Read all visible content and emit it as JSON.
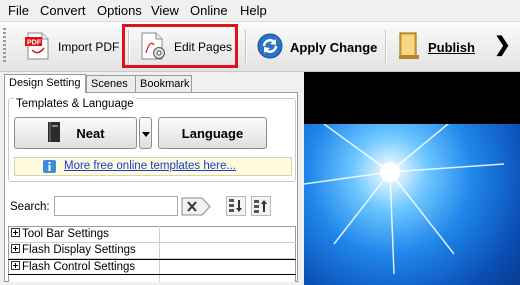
{
  "menu": [
    "File",
    "Convert",
    "Options",
    "View",
    "Online",
    "Help"
  ],
  "toolbar": {
    "import_pdf": "Import PDF",
    "edit_pages": "Edit Pages",
    "apply_change": "Apply Change",
    "publish": "Publish"
  },
  "tabs": [
    "Design Setting",
    "Scenes",
    "Bookmark"
  ],
  "templates_group": {
    "title": "Templates & Language",
    "template_button": "Neat",
    "language_button": "Language",
    "info_link": "More free online templates here..."
  },
  "search": {
    "label": "Search:",
    "value": ""
  },
  "settings_rows": [
    "Tool Bar Settings",
    "Flash Display Settings",
    "Flash Control Settings"
  ],
  "colors": {
    "highlight": "#d9151b",
    "link": "#1a3ccc",
    "preview_sky": "#1f86ea"
  },
  "icons": [
    "pdf-icon",
    "edit-pages-icon",
    "apply-change-icon",
    "publish-icon",
    "chevron-right-icon",
    "book-icon",
    "dropdown-arrow-icon",
    "info-icon",
    "clear-search-icon",
    "expand-icon",
    "collapse-icon"
  ]
}
